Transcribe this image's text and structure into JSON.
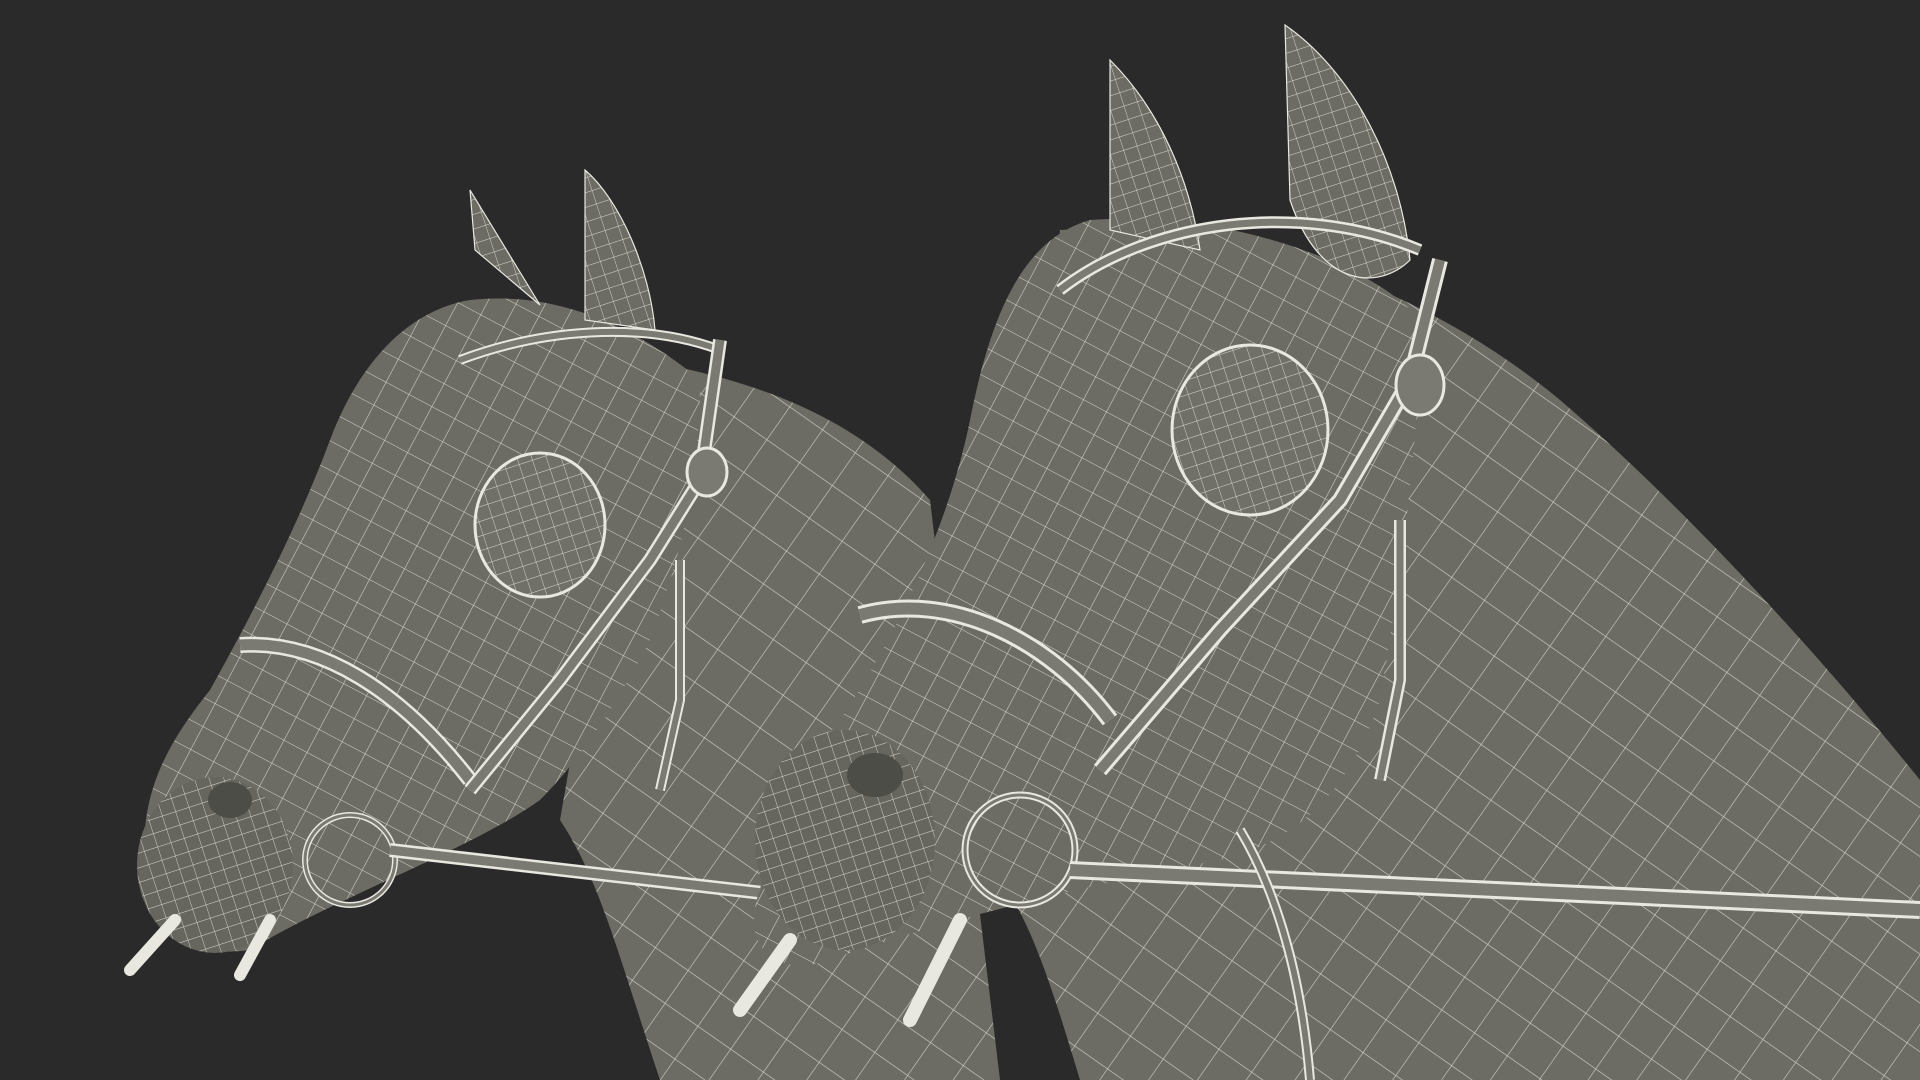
{
  "scene": {
    "background_color": "#2a2a2a",
    "mesh_fill_color": "#6c6c64",
    "mesh_dark_color": "#55554e",
    "wire_color": "#e8e8e0",
    "strap_color": "#7a7a72",
    "subjects": [
      "horse-head-back",
      "horse-head-front"
    ],
    "render_style": "wireframe-over-shaded"
  }
}
